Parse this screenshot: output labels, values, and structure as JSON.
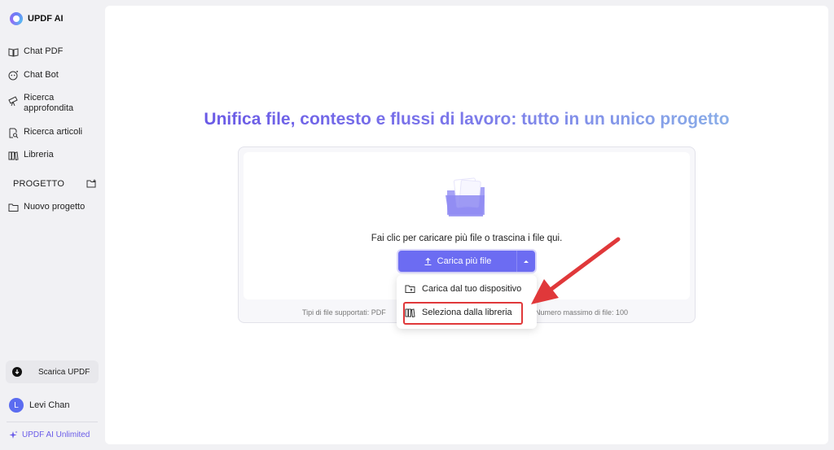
{
  "app": {
    "name": "UPDF AI"
  },
  "sidebar": {
    "items": [
      {
        "label": "Chat PDF",
        "icon": "book-open-icon"
      },
      {
        "label": "Chat Bot",
        "icon": "chat-bot-icon"
      },
      {
        "label": "Ricerca approfondita",
        "icon": "telescope-icon"
      },
      {
        "label": "Ricerca articoli",
        "icon": "document-search-icon"
      },
      {
        "label": "Libreria",
        "icon": "library-icon"
      }
    ],
    "section_title": "PROGETTO",
    "new_project_label": "Nuovo progetto",
    "download_label": "Scarica UPDF",
    "user": {
      "initial": "L",
      "name": "Levi Chan"
    },
    "plan_label": "UPDF AI Unlimited"
  },
  "main": {
    "headline": "Unifica file, contesto e flussi di lavoro: tutto in un unico progetto",
    "upload_hint": "Fai clic per caricare più file o trascina i file qui.",
    "upload_button_label": "Carica più file",
    "supported_types_prefix": "Tipi di file supportati: PDF",
    "max_files": "Numero massimo di file: 100"
  },
  "dropdown": {
    "items": [
      {
        "label": "Carica dal tuo dispositivo",
        "icon": "folder-upload-icon"
      },
      {
        "label": "Seleziona dalla libreria",
        "icon": "library-icon"
      }
    ]
  },
  "colors": {
    "accent": "#6c6cf2",
    "annotation": "#e0383a",
    "headline_start": "#6a5ae6",
    "headline_end": "#8aaee8"
  }
}
